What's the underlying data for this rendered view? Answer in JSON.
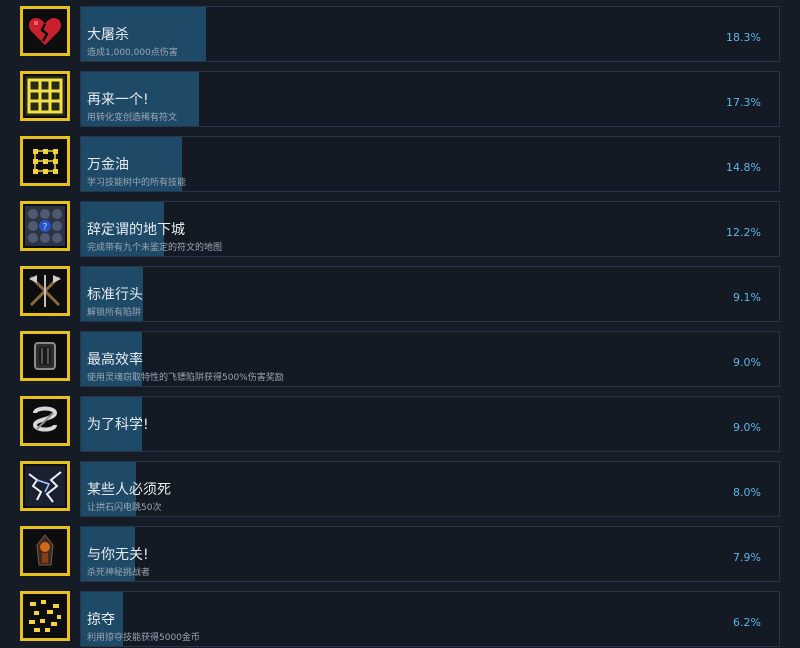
{
  "achievements": [
    {
      "name": "大屠杀",
      "description": "造成1,000,000点伤害",
      "percent_label": "18.3%",
      "percent": 18.3,
      "icon": "broken-heart-icon"
    },
    {
      "name": "再来一个!",
      "description": "用转化变创造稀有符文",
      "percent_label": "17.3%",
      "percent": 17.3,
      "icon": "glowing-grid-icon"
    },
    {
      "name": "万金油",
      "description": "学习技能树中的所有技能",
      "percent_label": "14.8%",
      "percent": 14.8,
      "icon": "skill-tree-icon"
    },
    {
      "name": "辞定谓的地下城",
      "description": "完成带有九个未鉴定的符文的地图",
      "percent_label": "12.2%",
      "percent": 12.2,
      "icon": "unidentified-runes-icon"
    },
    {
      "name": "标准行头",
      "description": "解锁所有陷阱",
      "percent_label": "9.1%",
      "percent": 9.1,
      "icon": "crossed-weapons-icon"
    },
    {
      "name": "最高效率",
      "description": "使用灵魂窃取特性的飞镖陷阱获得500%伤害奖励",
      "percent_label": "9.0%",
      "percent": 9.0,
      "icon": "dart-trap-icon"
    },
    {
      "name": "为了科学!",
      "description": "",
      "percent_label": "9.0%",
      "percent": 9.0,
      "icon": "science-coil-icon"
    },
    {
      "name": "某些人必须死",
      "description": "让拱石闪电跳50次",
      "percent_label": "8.0%",
      "percent": 8.0,
      "icon": "lightning-icon"
    },
    {
      "name": "与你无关!",
      "description": "杀死神秘挑战者",
      "percent_label": "7.9%",
      "percent": 7.9,
      "icon": "mysterious-challenger-icon"
    },
    {
      "name": "掠夺",
      "description": "利用掠夺技能获得5000金币",
      "percent_label": "6.2%",
      "percent": 6.2,
      "icon": "gold-coins-icon"
    }
  ],
  "colors": {
    "icon_border": "#e8c21c",
    "bar": "#1e4a68",
    "percent_text": "#62b4e8"
  }
}
